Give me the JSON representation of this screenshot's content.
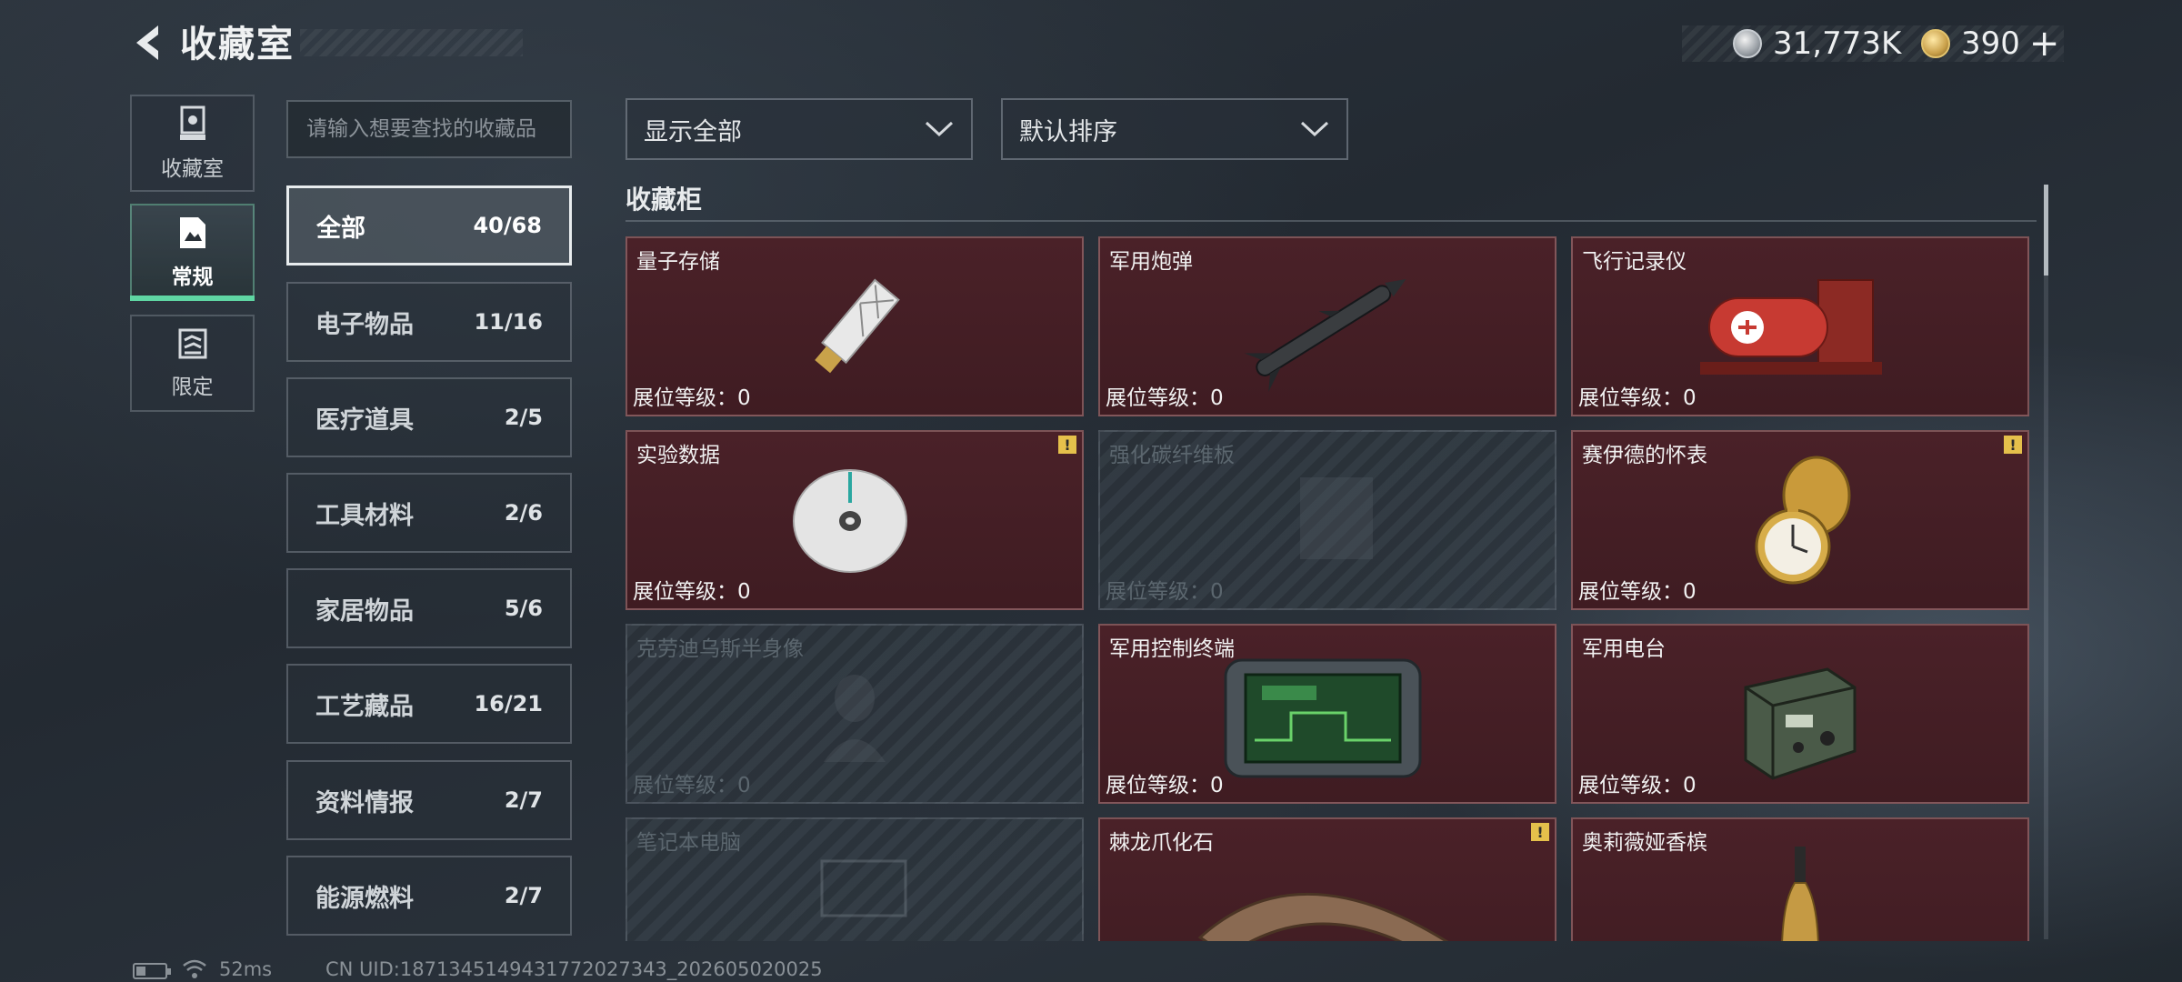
{
  "header": {
    "title": "收藏室",
    "currency": [
      {
        "icon": "silver-coin-icon",
        "value": "31,773K"
      },
      {
        "icon": "gold-coin-icon",
        "value": "390"
      }
    ],
    "plus_label": "+"
  },
  "nav": [
    {
      "label": "收藏室",
      "icon": "trophy-icon",
      "active": false
    },
    {
      "label": "常规",
      "icon": "document-icon",
      "active": true
    },
    {
      "label": "限定",
      "icon": "limited-icon",
      "active": false
    }
  ],
  "search": {
    "placeholder": "请输入想要查找的收藏品"
  },
  "categories": [
    {
      "name": "全部",
      "count": "40/68",
      "active": true
    },
    {
      "name": "电子物品",
      "count": "11/16"
    },
    {
      "name": "医疗道具",
      "count": "2/5"
    },
    {
      "name": "工具材料",
      "count": "2/6"
    },
    {
      "name": "家居物品",
      "count": "5/6"
    },
    {
      "name": "工艺藏品",
      "count": "16/21"
    },
    {
      "name": "资料情报",
      "count": "2/7"
    },
    {
      "name": "能源燃料",
      "count": "2/7"
    }
  ],
  "filters": {
    "display": "显示全部",
    "sort": "默认排序"
  },
  "section_title": "收藏柜",
  "items": [
    {
      "name": "量子存储",
      "level": "展位等级：0",
      "owned": true,
      "warn": false,
      "icon": "usb-drive-icon"
    },
    {
      "name": "军用炮弹",
      "level": "展位等级：0",
      "owned": true,
      "warn": false,
      "icon": "missile-icon"
    },
    {
      "name": "飞行记录仪",
      "level": "展位等级：0",
      "owned": true,
      "warn": false,
      "icon": "flight-recorder-icon"
    },
    {
      "name": "实验数据",
      "level": "展位等级：0",
      "owned": true,
      "warn": true,
      "icon": "disc-icon"
    },
    {
      "name": "强化碳纤维板",
      "level": "展位等级：0",
      "owned": false,
      "warn": false,
      "icon": "carbon-plate-icon"
    },
    {
      "name": "赛伊德的怀表",
      "level": "展位等级：0",
      "owned": true,
      "warn": true,
      "icon": "pocket-watch-icon"
    },
    {
      "name": "克劳迪乌斯半身像",
      "level": "展位等级：0",
      "owned": false,
      "warn": false,
      "icon": "bust-icon"
    },
    {
      "name": "军用控制终端",
      "level": "展位等级：0",
      "owned": true,
      "warn": false,
      "icon": "control-terminal-icon"
    },
    {
      "name": "军用电台",
      "level": "展位等级：0",
      "owned": true,
      "warn": false,
      "icon": "radio-icon"
    },
    {
      "name": "笔记本电脑",
      "level": "",
      "owned": false,
      "warn": false,
      "icon": "laptop-icon"
    },
    {
      "name": "棘龙爪化石",
      "level": "",
      "owned": true,
      "warn": true,
      "icon": "claw-fossil-icon"
    },
    {
      "name": "奥莉薇娅香槟",
      "level": "",
      "owned": true,
      "warn": false,
      "icon": "champagne-icon"
    }
  ],
  "warn_symbol": "!",
  "footer": {
    "ping": "52ms",
    "uid": "CN UID:1871345149431772027343_202605020025"
  }
}
